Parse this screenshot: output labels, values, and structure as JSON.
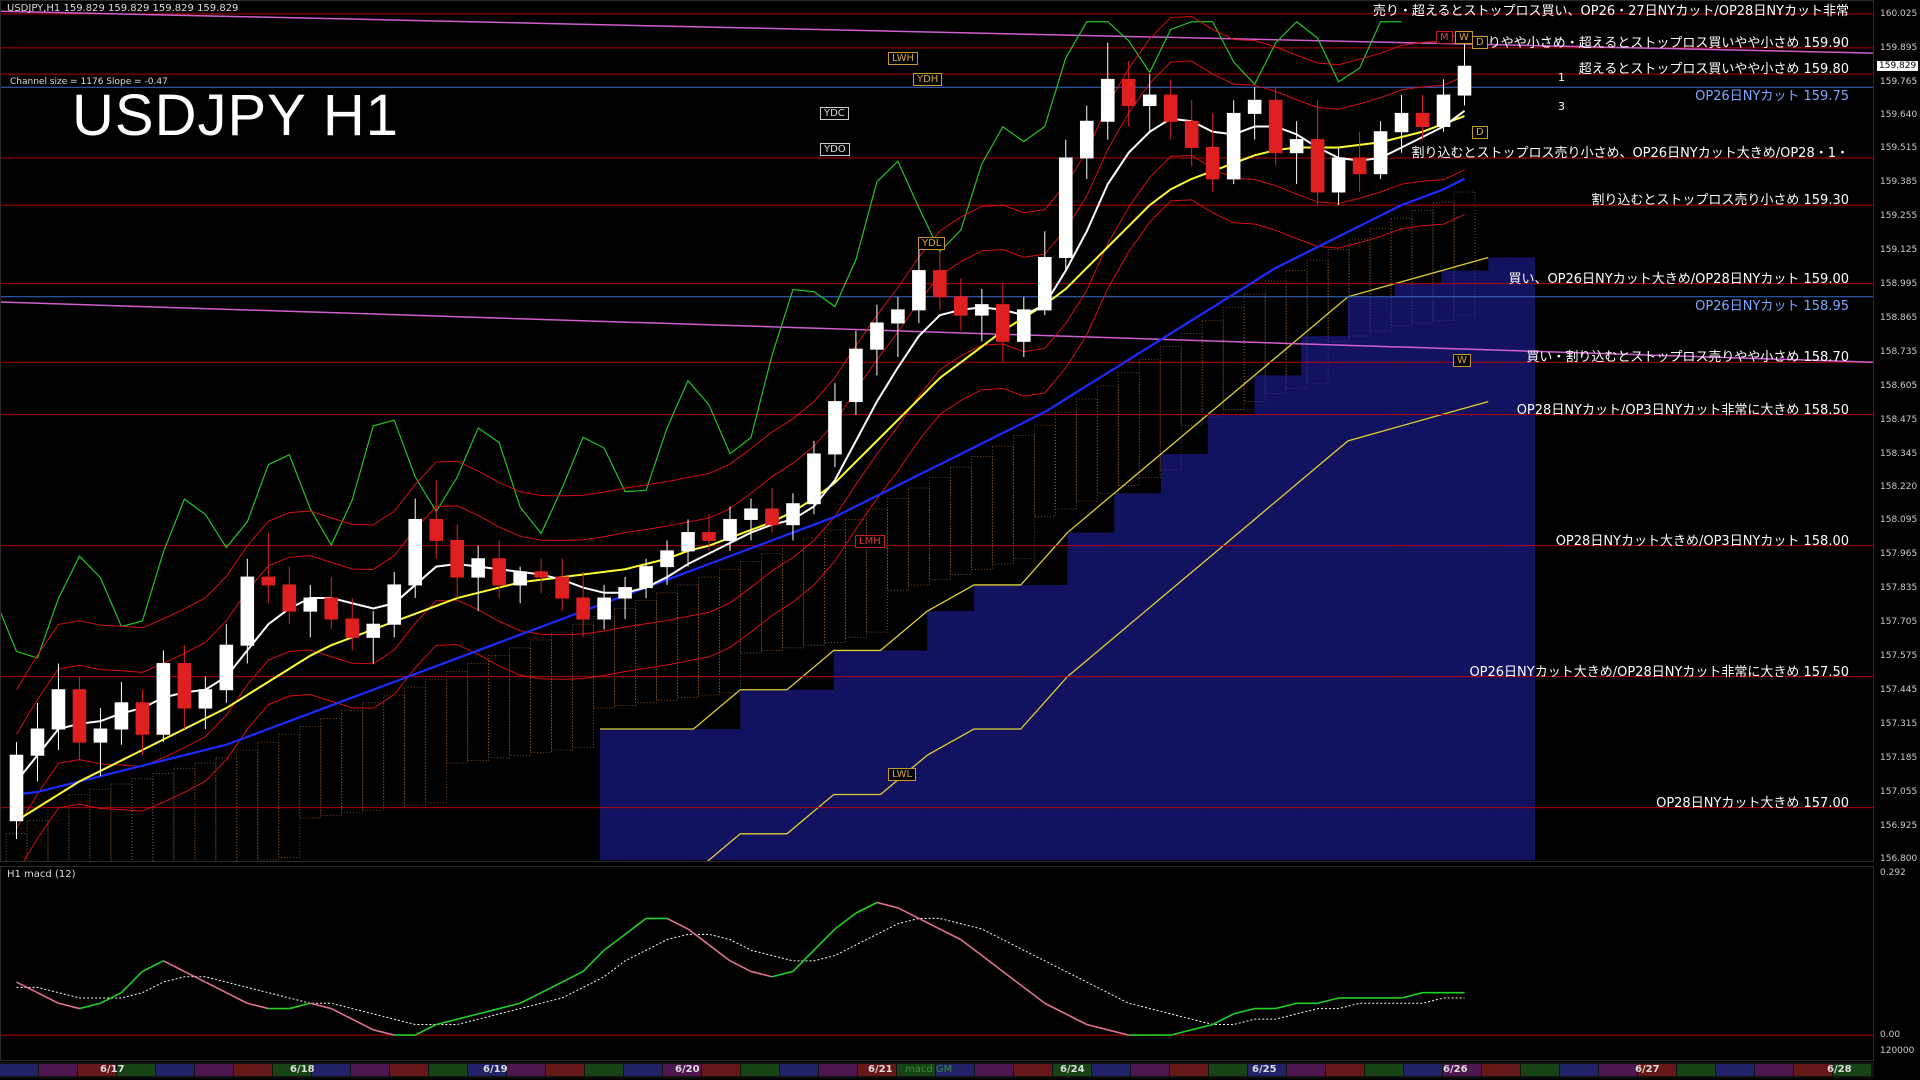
{
  "header": {
    "symbol_line": "USDJPY,H1  159.829 159.829 159.829 159.829",
    "channel_info": "Channel size = 1176 Slope = -0.47",
    "title": "USDJPY H1",
    "macd_label": "H1  macd (12)"
  },
  "annotations": [
    {
      "text": "売り・超えるとストップロス買い、OP26・27日NYカット/OP28日NYカット非常",
      "price": 160.03,
      "color": "white"
    },
    {
      "text": "売りやや小さめ・超えるとストップロス買いやや小さめ 159.90",
      "price": 159.9,
      "color": "white"
    },
    {
      "text": "超えるとストップロス買いやや小さめ 159.80",
      "price": 159.8,
      "color": "white"
    },
    {
      "text": "OP26日NYカット 159.75",
      "price": 159.75,
      "color": "blue"
    },
    {
      "text": "割り込むとストップロス売り小さめ、OP26日NYカット大きめ/OP28・1・",
      "price": 159.48,
      "color": "white"
    },
    {
      "text": "割り込むとストップロス売り小さめ 159.30",
      "price": 159.3,
      "color": "white"
    },
    {
      "text": "買い、OP26日NYカット大きめ/OP28日NYカット 159.00",
      "price": 159.0,
      "color": "white"
    },
    {
      "text": "OP26日NYカット 158.95",
      "price": 158.95,
      "color": "blue"
    },
    {
      "text": "買い・割り込むとストップロス売りやや小さめ 158.70",
      "price": 158.7,
      "color": "white"
    },
    {
      "text": "OP28日NYカット/OP3日NYカット非常に大きめ 158.50",
      "price": 158.5,
      "color": "white"
    },
    {
      "text": "OP28日NYカット大きめ/OP3日NYカット 158.00",
      "price": 158.0,
      "color": "white"
    },
    {
      "text": "OP26日NYカット大きめ/OP28日NYカット非常に大きめ 157.50",
      "price": 157.5,
      "color": "white"
    },
    {
      "text": "OP28日NYカット大きめ 157.00",
      "price": 157.0,
      "color": "white"
    }
  ],
  "tags": [
    {
      "text": "LWH",
      "style": "gold"
    },
    {
      "text": "YDH",
      "style": "gold"
    },
    {
      "text": "YDC",
      "style": "white"
    },
    {
      "text": "YDO",
      "style": "white"
    },
    {
      "text": "YDL",
      "style": "gold"
    },
    {
      "text": "LMH",
      "style": "red"
    },
    {
      "text": "LWL",
      "style": "gold"
    },
    {
      "text": "W",
      "style": "gold"
    },
    {
      "text": "M",
      "style": "red"
    },
    {
      "text": "W",
      "style": "gold"
    },
    {
      "text": "D",
      "style": "gold"
    },
    {
      "text": "D",
      "style": "gold"
    }
  ],
  "channel_labels": [
    "1",
    "3"
  ],
  "current_price": "159.829",
  "price_ticks": [
    "160.025",
    "159.895",
    "159.765",
    "159.640",
    "159.515",
    "159.385",
    "159.255",
    "159.125",
    "158.995",
    "158.865",
    "158.735",
    "158.605",
    "158.475",
    "158.345",
    "158.220",
    "158.095",
    "157.965",
    "157.835",
    "157.705",
    "157.575",
    "157.445",
    "157.315",
    "157.185",
    "157.055",
    "156.925",
    "156.800"
  ],
  "macd_ticks": [
    "0.292",
    "0.00",
    "120000"
  ],
  "date_labels": [
    "6/17",
    "6/18",
    "6/19",
    "6/20",
    "6/21",
    "6/24",
    "6/25",
    "6/26",
    "6/27",
    "6/28"
  ],
  "macd_watermark": "macd GM",
  "colors": {
    "ma_fast": "#ffffff",
    "ma_mid": "#ffff30",
    "ma_slow": "#1a2cff",
    "envelope": "#d61010",
    "chikou": "#22c522",
    "cloud_blue": "#2020b0",
    "cloud_orange": "#d08040",
    "annotation_line": "#b00000",
    "macd_main": "#22d022",
    "macd_signal": "#ffffff"
  },
  "chart_data": {
    "type": "candlestick",
    "title": "USDJPY H1",
    "ylim": [
      156.8,
      160.06
    ],
    "candles": [
      [
        156.95,
        157.25,
        156.88,
        157.2
      ],
      [
        157.2,
        157.4,
        157.1,
        157.3
      ],
      [
        157.3,
        157.55,
        157.22,
        157.45
      ],
      [
        157.45,
        157.5,
        157.18,
        157.25
      ],
      [
        157.25,
        157.38,
        157.12,
        157.3
      ],
      [
        157.3,
        157.48,
        157.24,
        157.4
      ],
      [
        157.4,
        157.45,
        157.2,
        157.28
      ],
      [
        157.28,
        157.6,
        157.25,
        157.55
      ],
      [
        157.55,
        157.62,
        157.3,
        157.38
      ],
      [
        157.38,
        157.5,
        157.3,
        157.45
      ],
      [
        157.45,
        157.7,
        157.4,
        157.62
      ],
      [
        157.62,
        157.95,
        157.55,
        157.88
      ],
      [
        157.88,
        158.05,
        157.78,
        157.85
      ],
      [
        157.85,
        157.92,
        157.7,
        157.75
      ],
      [
        157.75,
        157.85,
        157.65,
        157.8
      ],
      [
        157.8,
        157.88,
        157.68,
        157.72
      ],
      [
        157.72,
        157.8,
        157.6,
        157.65
      ],
      [
        157.65,
        157.75,
        157.55,
        157.7
      ],
      [
        157.7,
        157.9,
        157.65,
        157.85
      ],
      [
        157.85,
        158.18,
        157.8,
        158.1
      ],
      [
        158.1,
        158.25,
        157.95,
        158.02
      ],
      [
        158.02,
        158.08,
        157.8,
        157.88
      ],
      [
        157.88,
        158.0,
        157.75,
        157.95
      ],
      [
        157.95,
        158.02,
        157.8,
        157.85
      ],
      [
        157.85,
        157.92,
        157.78,
        157.9
      ],
      [
        157.9,
        157.95,
        157.82,
        157.88
      ],
      [
        157.88,
        157.95,
        157.75,
        157.8
      ],
      [
        157.8,
        157.9,
        157.65,
        157.72
      ],
      [
        157.72,
        157.85,
        157.68,
        157.8
      ],
      [
        157.8,
        157.88,
        157.72,
        157.84
      ],
      [
        157.84,
        157.95,
        157.8,
        157.92
      ],
      [
        157.92,
        158.02,
        157.85,
        157.98
      ],
      [
        157.98,
        158.1,
        157.92,
        158.05
      ],
      [
        158.05,
        158.12,
        157.98,
        158.02
      ],
      [
        158.02,
        158.15,
        157.98,
        158.1
      ],
      [
        158.1,
        158.18,
        158.02,
        158.14
      ],
      [
        158.14,
        158.22,
        158.05,
        158.08
      ],
      [
        158.08,
        158.2,
        158.02,
        158.16
      ],
      [
        158.16,
        158.4,
        158.12,
        158.35
      ],
      [
        158.35,
        158.62,
        158.3,
        158.55
      ],
      [
        158.55,
        158.82,
        158.5,
        158.75
      ],
      [
        158.75,
        158.92,
        158.65,
        158.85
      ],
      [
        158.85,
        158.95,
        158.72,
        158.9
      ],
      [
        158.9,
        159.15,
        158.85,
        159.05
      ],
      [
        159.05,
        159.12,
        158.9,
        158.95
      ],
      [
        158.95,
        159.02,
        158.82,
        158.88
      ],
      [
        158.88,
        158.98,
        158.78,
        158.92
      ],
      [
        158.92,
        159.0,
        158.7,
        158.78
      ],
      [
        158.78,
        158.95,
        158.72,
        158.9
      ],
      [
        158.9,
        159.2,
        158.88,
        159.1
      ],
      [
        159.1,
        159.55,
        159.05,
        159.48
      ],
      [
        159.48,
        159.68,
        159.4,
        159.62
      ],
      [
        159.62,
        159.92,
        159.55,
        159.78
      ],
      [
        159.78,
        159.85,
        159.6,
        159.68
      ],
      [
        159.68,
        159.8,
        159.58,
        159.72
      ],
      [
        159.72,
        159.78,
        159.55,
        159.62
      ],
      [
        159.62,
        159.7,
        159.45,
        159.52
      ],
      [
        159.52,
        159.65,
        159.35,
        159.4
      ],
      [
        159.4,
        159.7,
        159.38,
        159.65
      ],
      [
        159.65,
        159.75,
        159.55,
        159.7
      ],
      [
        159.7,
        159.75,
        159.45,
        159.5
      ],
      [
        159.5,
        159.62,
        159.38,
        159.55
      ],
      [
        159.55,
        159.7,
        159.3,
        159.35
      ],
      [
        159.35,
        159.52,
        159.3,
        159.48
      ],
      [
        159.48,
        159.58,
        159.35,
        159.42
      ],
      [
        159.42,
        159.62,
        159.4,
        159.58
      ],
      [
        159.58,
        159.72,
        159.5,
        159.65
      ],
      [
        159.65,
        159.72,
        159.55,
        159.6
      ],
      [
        159.6,
        159.78,
        159.58,
        159.72
      ],
      [
        159.72,
        159.92,
        159.68,
        159.83
      ]
    ],
    "ma_fast": [
      157.1,
      157.2,
      157.3,
      157.32,
      157.33,
      157.36,
      157.38,
      157.42,
      157.44,
      157.45,
      157.5,
      157.6,
      157.7,
      157.76,
      157.8,
      157.8,
      157.78,
      157.76,
      157.78,
      157.85,
      157.92,
      157.93,
      157.92,
      157.91,
      157.9,
      157.89,
      157.87,
      157.84,
      157.82,
      157.82,
      157.84,
      157.88,
      157.93,
      157.97,
      158.01,
      158.05,
      158.08,
      158.1,
      158.15,
      158.25,
      158.4,
      158.55,
      158.68,
      158.8,
      158.88,
      158.9,
      158.91,
      158.9,
      158.88,
      158.92,
      159.05,
      159.2,
      159.38,
      159.5,
      159.58,
      159.63,
      159.62,
      159.58,
      159.57,
      159.6,
      159.6,
      159.57,
      159.52,
      159.48,
      159.47,
      159.48,
      159.52,
      159.56,
      159.6,
      159.66
    ],
    "ma_mid": [
      156.95,
      157.0,
      157.05,
      157.1,
      157.14,
      157.18,
      157.22,
      157.26,
      157.3,
      157.34,
      157.38,
      157.43,
      157.48,
      157.53,
      157.58,
      157.62,
      157.65,
      157.68,
      157.71,
      157.74,
      157.77,
      157.8,
      157.82,
      157.84,
      157.86,
      157.87,
      157.88,
      157.89,
      157.9,
      157.91,
      157.93,
      157.95,
      157.98,
      158.0,
      158.03,
      158.06,
      158.09,
      158.13,
      158.18,
      158.24,
      158.32,
      158.4,
      158.48,
      158.56,
      158.64,
      158.7,
      158.76,
      158.82,
      158.87,
      158.92,
      158.98,
      159.06,
      159.14,
      159.22,
      159.3,
      159.36,
      159.4,
      159.43,
      159.46,
      159.49,
      159.51,
      159.52,
      159.52,
      159.52,
      159.53,
      159.54,
      159.56,
      159.58,
      159.61,
      159.64
    ],
    "ma_slow": [
      157.05,
      157.06,
      157.08,
      157.1,
      157.12,
      157.14,
      157.16,
      157.18,
      157.2,
      157.22,
      157.24,
      157.27,
      157.3,
      157.33,
      157.36,
      157.39,
      157.42,
      157.45,
      157.48,
      157.51,
      157.54,
      157.57,
      157.6,
      157.63,
      157.66,
      157.69,
      157.72,
      157.75,
      157.78,
      157.81,
      157.84,
      157.87,
      157.9,
      157.93,
      157.96,
      157.99,
      158.02,
      158.05,
      158.08,
      158.11,
      158.15,
      158.19,
      158.23,
      158.27,
      158.31,
      158.35,
      158.39,
      158.43,
      158.47,
      158.51,
      158.56,
      158.61,
      158.66,
      158.71,
      158.76,
      158.81,
      158.86,
      158.91,
      158.96,
      159.01,
      159.06,
      159.1,
      159.14,
      159.18,
      159.22,
      159.26,
      159.3,
      159.33,
      159.36,
      159.4
    ],
    "macd_main": [
      0.1,
      0.08,
      0.06,
      0.05,
      0.06,
      0.08,
      0.12,
      0.14,
      0.12,
      0.1,
      0.08,
      0.06,
      0.05,
      0.05,
      0.06,
      0.05,
      0.03,
      0.01,
      0.0,
      0.0,
      0.02,
      0.03,
      0.04,
      0.05,
      0.06,
      0.08,
      0.1,
      0.12,
      0.16,
      0.19,
      0.22,
      0.22,
      0.2,
      0.17,
      0.14,
      0.12,
      0.11,
      0.12,
      0.16,
      0.2,
      0.23,
      0.25,
      0.24,
      0.22,
      0.2,
      0.18,
      0.15,
      0.12,
      0.09,
      0.06,
      0.04,
      0.02,
      0.01,
      0.0,
      0.0,
      0.0,
      0.01,
      0.02,
      0.04,
      0.05,
      0.05,
      0.06,
      0.06,
      0.07,
      0.07,
      0.07,
      0.07,
      0.08,
      0.08,
      0.08
    ],
    "macd_signal": [
      0.09,
      0.09,
      0.08,
      0.07,
      0.07,
      0.07,
      0.08,
      0.1,
      0.11,
      0.11,
      0.1,
      0.09,
      0.08,
      0.07,
      0.06,
      0.06,
      0.05,
      0.04,
      0.03,
      0.02,
      0.02,
      0.02,
      0.03,
      0.04,
      0.05,
      0.06,
      0.07,
      0.09,
      0.11,
      0.14,
      0.16,
      0.18,
      0.19,
      0.19,
      0.18,
      0.16,
      0.15,
      0.14,
      0.14,
      0.15,
      0.17,
      0.19,
      0.21,
      0.22,
      0.22,
      0.21,
      0.2,
      0.18,
      0.16,
      0.14,
      0.12,
      0.1,
      0.08,
      0.06,
      0.05,
      0.04,
      0.03,
      0.02,
      0.02,
      0.03,
      0.03,
      0.04,
      0.05,
      0.05,
      0.06,
      0.06,
      0.06,
      0.06,
      0.07,
      0.07
    ],
    "macd_ylim": [
      -0.03,
      0.3
    ]
  }
}
